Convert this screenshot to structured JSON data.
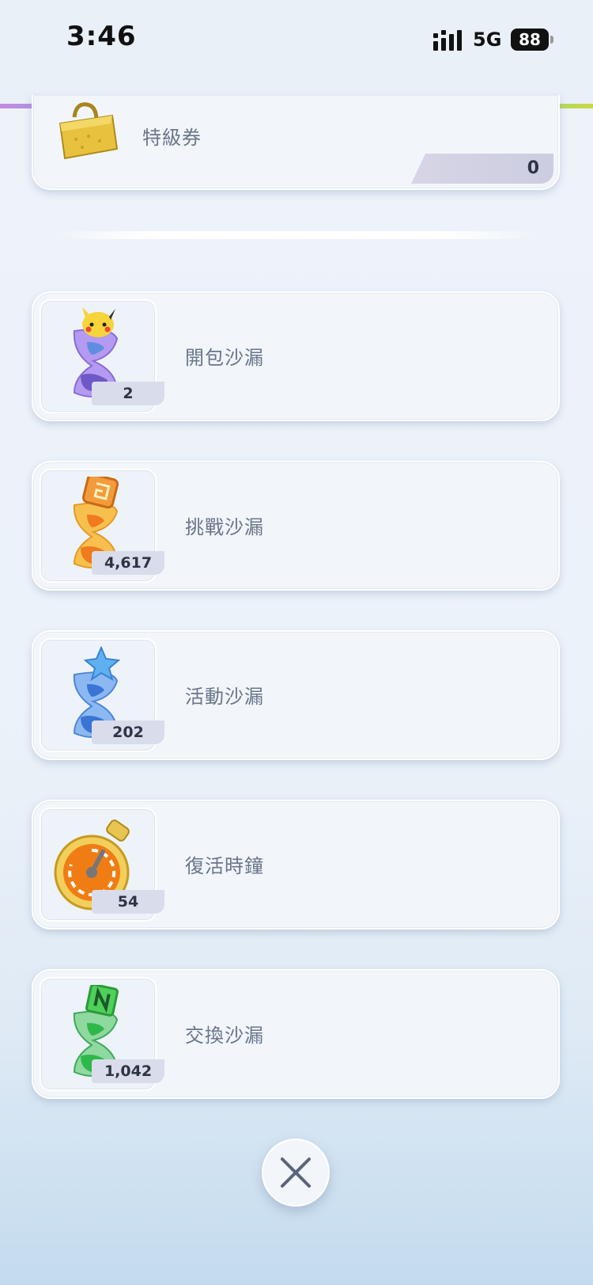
{
  "status_bar": {
    "time": "3:46",
    "network": "5G",
    "battery": "88"
  },
  "items": [
    {
      "label": "特級券",
      "count": "0",
      "icon": "gold-shopping-bag-icon"
    },
    {
      "label": "開包沙漏",
      "count": "2",
      "icon": "pack-hourglass-icon",
      "color": "#9b7ce8"
    },
    {
      "label": "挑戰沙漏",
      "count": "4,617",
      "icon": "challenge-hourglass-icon",
      "color": "#f2a23a"
    },
    {
      "label": "活動沙漏",
      "count": "202",
      "icon": "event-hourglass-icon",
      "color": "#5e9de8"
    },
    {
      "label": "復活時鐘",
      "count": "54",
      "icon": "revive-clock-icon",
      "color": "#f08a1e"
    },
    {
      "label": "交換沙漏",
      "count": "1,042",
      "icon": "trade-hourglass-icon",
      "color": "#3ec85a"
    }
  ],
  "close_button": {
    "icon": "close-icon"
  }
}
